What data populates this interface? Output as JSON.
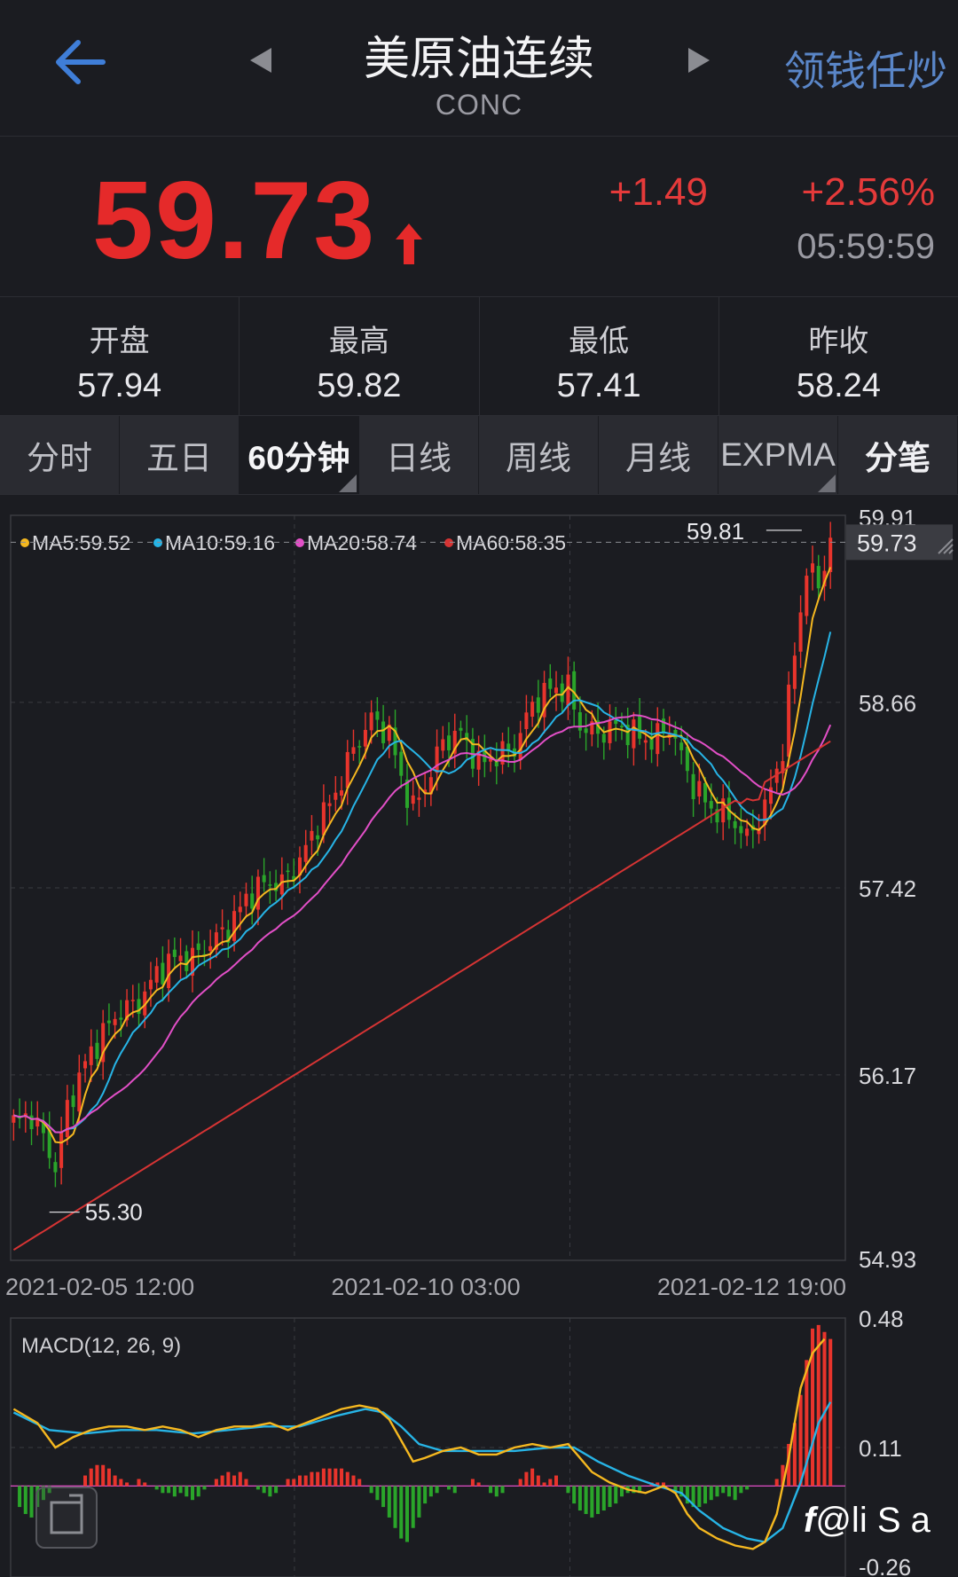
{
  "header": {
    "title": "美原油连续",
    "code": "CONC",
    "right_label": "领钱任炒"
  },
  "quote": {
    "price": "59.73",
    "change": "+1.49",
    "change_pct": "+2.56%",
    "time": "05:59:59",
    "direction": "up",
    "color_up": "#e52a2a"
  },
  "stats": [
    {
      "label": "开盘",
      "value": "57.94"
    },
    {
      "label": "最高",
      "value": "59.82"
    },
    {
      "label": "最低",
      "value": "57.41"
    },
    {
      "label": "昨收",
      "value": "58.24"
    }
  ],
  "tabs": [
    {
      "label": "分时",
      "active": false
    },
    {
      "label": "五日",
      "active": false
    },
    {
      "label": "60分钟",
      "active": true
    },
    {
      "label": "日线",
      "active": false
    },
    {
      "label": "周线",
      "active": false
    },
    {
      "label": "月线",
      "active": false
    },
    {
      "label": "EXPMA",
      "active": false
    },
    {
      "label": "分笔",
      "active": false
    }
  ],
  "chart_data": [
    {
      "type": "candlestick",
      "legend": [
        {
          "label": "MA5:59.52",
          "color": "#f5b820"
        },
        {
          "label": "MA10:59.16",
          "color": "#27b4e6"
        },
        {
          "label": "MA20:58.74",
          "color": "#e24fc7"
        },
        {
          "label": "MA60:58.35",
          "color": "#d63434"
        }
      ],
      "y_ticks": [
        "59.91",
        "58.66",
        "57.42",
        "56.17",
        "54.93"
      ],
      "ylim": [
        54.93,
        59.91
      ],
      "x_ticks": [
        "2021-02-05 12:00",
        "2021-02-10 03:00",
        "2021-02-12 19:00"
      ],
      "current_price_label": "59.73",
      "current_price": 59.73,
      "high_label": "59.81",
      "low_label": "55.30",
      "close_path": [
        [
          0,
          55.85
        ],
        [
          3,
          55.9
        ],
        [
          5,
          55.75
        ],
        [
          7,
          55.55
        ],
        [
          9,
          55.95
        ],
        [
          12,
          56.25
        ],
        [
          15,
          56.45
        ],
        [
          18,
          56.6
        ],
        [
          21,
          56.65
        ],
        [
          24,
          56.85
        ],
        [
          27,
          56.95
        ],
        [
          30,
          56.95
        ],
        [
          33,
          57.05
        ],
        [
          36,
          57.15
        ],
        [
          39,
          57.35
        ],
        [
          42,
          57.45
        ],
        [
          45,
          57.45
        ],
        [
          48,
          57.6
        ],
        [
          51,
          57.85
        ],
        [
          54,
          58.05
        ],
        [
          57,
          58.35
        ],
        [
          60,
          58.55
        ],
        [
          63,
          58.45
        ],
        [
          65,
          58.15
        ],
        [
          67,
          57.95
        ],
        [
          69,
          58.1
        ],
        [
          72,
          58.4
        ],
        [
          75,
          58.45
        ],
        [
          78,
          58.25
        ],
        [
          81,
          58.3
        ],
        [
          84,
          58.35
        ],
        [
          87,
          58.65
        ],
        [
          90,
          58.75
        ],
        [
          93,
          58.75
        ],
        [
          95,
          58.5
        ],
        [
          98,
          58.45
        ],
        [
          101,
          58.5
        ],
        [
          104,
          58.45
        ],
        [
          107,
          58.4
        ],
        [
          110,
          58.5
        ],
        [
          112,
          58.3
        ],
        [
          114,
          58.1
        ],
        [
          117,
          57.95
        ],
        [
          120,
          57.9
        ],
        [
          123,
          57.75
        ],
        [
          126,
          57.95
        ],
        [
          129,
          58.35
        ],
        [
          131,
          59.0
        ],
        [
          133,
          59.55
        ],
        [
          135,
          59.45
        ],
        [
          137,
          59.73
        ]
      ],
      "ma5_end": 59.52,
      "ma10_end": 59.16,
      "ma20_end": 58.74,
      "ma60_end": 58.35
    },
    {
      "type": "macd",
      "title": "MACD(12, 26, 9)",
      "y_ticks": [
        "0.48",
        "0.11",
        "-0.26"
      ],
      "ylim": [
        -0.26,
        0.48
      ],
      "dif_color": "#f5b820",
      "dea_color": "#27b4e6",
      "dif": [
        [
          0,
          0.22
        ],
        [
          4,
          0.18
        ],
        [
          7,
          0.11
        ],
        [
          10,
          0.14
        ],
        [
          13,
          0.16
        ],
        [
          16,
          0.17
        ],
        [
          19,
          0.17
        ],
        [
          22,
          0.16
        ],
        [
          25,
          0.17
        ],
        [
          28,
          0.16
        ],
        [
          31,
          0.14
        ],
        [
          34,
          0.16
        ],
        [
          37,
          0.17
        ],
        [
          40,
          0.17
        ],
        [
          43,
          0.18
        ],
        [
          46,
          0.16
        ],
        [
          49,
          0.18
        ],
        [
          52,
          0.2
        ],
        [
          55,
          0.22
        ],
        [
          58,
          0.23
        ],
        [
          61,
          0.22
        ],
        [
          63,
          0.19
        ],
        [
          65,
          0.13
        ],
        [
          67,
          0.07
        ],
        [
          69,
          0.08
        ],
        [
          72,
          0.1
        ],
        [
          75,
          0.11
        ],
        [
          78,
          0.09
        ],
        [
          81,
          0.09
        ],
        [
          84,
          0.11
        ],
        [
          87,
          0.12
        ],
        [
          90,
          0.11
        ],
        [
          93,
          0.12
        ],
        [
          95,
          0.08
        ],
        [
          97,
          0.04
        ],
        [
          100,
          0.01
        ],
        [
          103,
          -0.01
        ],
        [
          106,
          -0.02
        ],
        [
          109,
          0.0
        ],
        [
          111,
          -0.02
        ],
        [
          113,
          -0.08
        ],
        [
          115,
          -0.12
        ],
        [
          118,
          -0.15
        ],
        [
          121,
          -0.17
        ],
        [
          124,
          -0.18
        ],
        [
          126,
          -0.16
        ],
        [
          128,
          -0.08
        ],
        [
          130,
          0.08
        ],
        [
          132,
          0.28
        ],
        [
          134,
          0.38
        ],
        [
          136,
          0.42
        ]
      ],
      "dea": [
        [
          0,
          0.21
        ],
        [
          6,
          0.16
        ],
        [
          12,
          0.15
        ],
        [
          18,
          0.16
        ],
        [
          24,
          0.16
        ],
        [
          30,
          0.15
        ],
        [
          36,
          0.16
        ],
        [
          42,
          0.17
        ],
        [
          48,
          0.17
        ],
        [
          54,
          0.2
        ],
        [
          59,
          0.22
        ],
        [
          62,
          0.21
        ],
        [
          65,
          0.17
        ],
        [
          68,
          0.12
        ],
        [
          72,
          0.1
        ],
        [
          78,
          0.1
        ],
        [
          84,
          0.1
        ],
        [
          90,
          0.11
        ],
        [
          94,
          0.11
        ],
        [
          98,
          0.07
        ],
        [
          103,
          0.03
        ],
        [
          108,
          0.0
        ],
        [
          112,
          -0.02
        ],
        [
          115,
          -0.07
        ],
        [
          119,
          -0.12
        ],
        [
          123,
          -0.15
        ],
        [
          126,
          -0.16
        ],
        [
          129,
          -0.12
        ],
        [
          132,
          0.01
        ],
        [
          135,
          0.18
        ],
        [
          137,
          0.24
        ]
      ],
      "hist": [
        [
          1,
          -0.06
        ],
        [
          2,
          -0.08
        ],
        [
          3,
          -0.09
        ],
        [
          4,
          -0.06
        ],
        [
          5,
          -0.04
        ],
        [
          6,
          -0.02
        ],
        [
          12,
          0.03
        ],
        [
          13,
          0.05
        ],
        [
          14,
          0.06
        ],
        [
          15,
          0.06
        ],
        [
          16,
          0.05
        ],
        [
          17,
          0.03
        ],
        [
          18,
          0.02
        ],
        [
          19,
          0.01
        ],
        [
          21,
          0.02
        ],
        [
          22,
          0.01
        ],
        [
          24,
          -0.01
        ],
        [
          25,
          -0.02
        ],
        [
          26,
          -0.02
        ],
        [
          27,
          -0.03
        ],
        [
          28,
          -0.02
        ],
        [
          29,
          -0.03
        ],
        [
          30,
          -0.04
        ],
        [
          31,
          -0.03
        ],
        [
          32,
          -0.01
        ],
        [
          34,
          0.02
        ],
        [
          35,
          0.03
        ],
        [
          36,
          0.04
        ],
        [
          37,
          0.03
        ],
        [
          38,
          0.04
        ],
        [
          39,
          0.02
        ],
        [
          41,
          -0.01
        ],
        [
          42,
          -0.02
        ],
        [
          43,
          -0.03
        ],
        [
          44,
          -0.02
        ],
        [
          46,
          0.02
        ],
        [
          47,
          0.02
        ],
        [
          48,
          0.03
        ],
        [
          49,
          0.03
        ],
        [
          50,
          0.04
        ],
        [
          51,
          0.04
        ],
        [
          52,
          0.05
        ],
        [
          53,
          0.05
        ],
        [
          54,
          0.05
        ],
        [
          55,
          0.05
        ],
        [
          56,
          0.04
        ],
        [
          57,
          0.03
        ],
        [
          58,
          0.02
        ],
        [
          60,
          -0.02
        ],
        [
          61,
          -0.04
        ],
        [
          62,
          -0.06
        ],
        [
          63,
          -0.09
        ],
        [
          64,
          -0.12
        ],
        [
          65,
          -0.15
        ],
        [
          66,
          -0.16
        ],
        [
          67,
          -0.12
        ],
        [
          68,
          -0.09
        ],
        [
          69,
          -0.05
        ],
        [
          70,
          -0.03
        ],
        [
          71,
          -0.02
        ],
        [
          73,
          -0.01
        ],
        [
          74,
          -0.02
        ],
        [
          77,
          0.02
        ],
        [
          78,
          0.01
        ],
        [
          79,
          0.0
        ],
        [
          80,
          -0.02
        ],
        [
          81,
          -0.03
        ],
        [
          82,
          -0.02
        ],
        [
          85,
          0.02
        ],
        [
          86,
          0.04
        ],
        [
          87,
          0.05
        ],
        [
          88,
          0.03
        ],
        [
          89,
          0.01
        ],
        [
          90,
          0.02
        ],
        [
          91,
          0.03
        ],
        [
          93,
          -0.02
        ],
        [
          94,
          -0.05
        ],
        [
          95,
          -0.07
        ],
        [
          96,
          -0.08
        ],
        [
          97,
          -0.09
        ],
        [
          98,
          -0.08
        ],
        [
          99,
          -0.07
        ],
        [
          100,
          -0.06
        ],
        [
          101,
          -0.05
        ],
        [
          102,
          -0.03
        ],
        [
          103,
          -0.02
        ],
        [
          104,
          -0.02
        ],
        [
          105,
          -0.02
        ],
        [
          107,
          0.01
        ],
        [
          108,
          0.01
        ],
        [
          109,
          0.01
        ],
        [
          111,
          -0.02
        ],
        [
          112,
          -0.03
        ],
        [
          113,
          -0.05
        ],
        [
          114,
          -0.06
        ],
        [
          115,
          -0.06
        ],
        [
          116,
          -0.05
        ],
        [
          117,
          -0.04
        ],
        [
          118,
          -0.03
        ],
        [
          119,
          -0.02
        ],
        [
          120,
          -0.03
        ],
        [
          121,
          -0.04
        ],
        [
          122,
          -0.02
        ],
        [
          123,
          -0.01
        ],
        [
          128,
          0.02
        ],
        [
          129,
          0.06
        ],
        [
          130,
          0.12
        ],
        [
          131,
          0.18
        ],
        [
          132,
          0.26
        ],
        [
          133,
          0.36
        ],
        [
          134,
          0.45
        ],
        [
          135,
          0.46
        ],
        [
          136,
          0.44
        ],
        [
          137,
          0.42
        ]
      ]
    }
  ],
  "watermark": "@li S a"
}
